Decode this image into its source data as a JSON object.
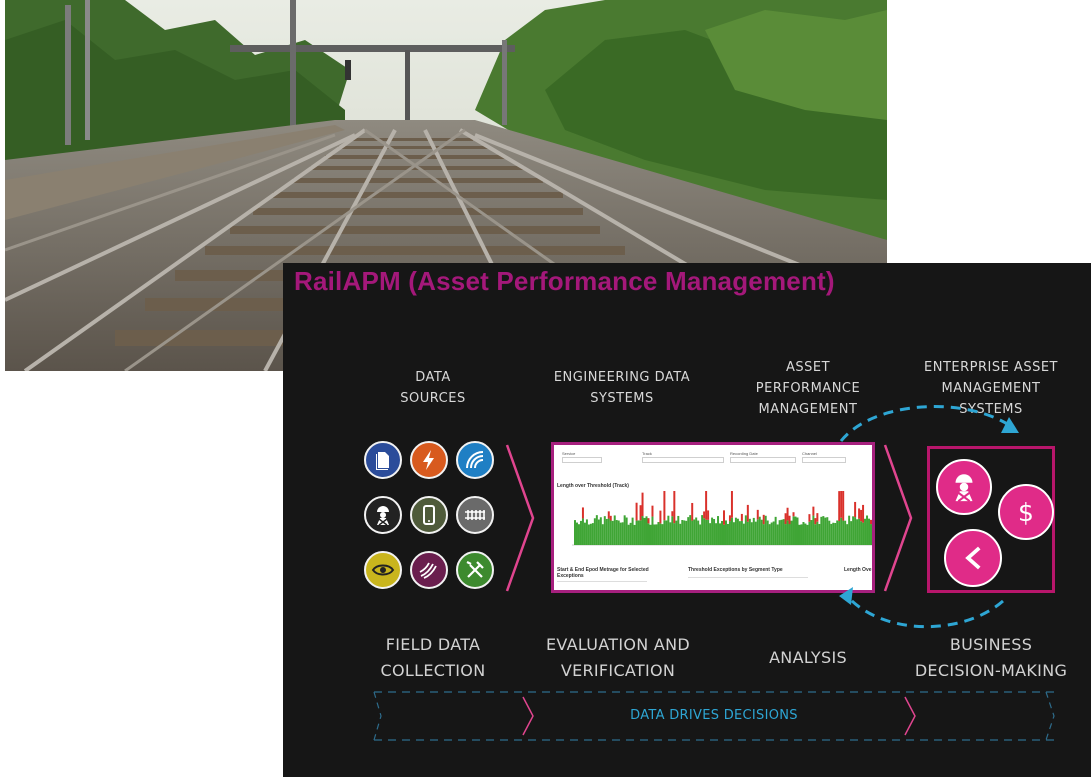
{
  "photo": {
    "description_icon": "railway-track-photo"
  },
  "slide": {
    "title": "RailAPM (Asset Performance Management)",
    "title_color": "#a4187a",
    "background": "#161616",
    "accent_pink": "#b8166b",
    "accent_blue": "#2ea6d4",
    "columns": [
      {
        "head": [
          "DATA",
          "SOURCES"
        ],
        "stage": [
          "FIELD DATA",
          "COLLECTION"
        ]
      },
      {
        "head": [
          "ENGINEERING DATA",
          "SYSTEMS"
        ],
        "stage": [
          "EVALUATION AND",
          "VERIFICATION"
        ]
      },
      {
        "head": [
          "ASSET",
          "PERFORMANCE",
          "MANAGEMENT"
        ],
        "stage": [
          "ANALYSIS"
        ]
      },
      {
        "head": [
          "ENTERPRISE ASSET",
          "MANAGEMENT",
          "SYSTEMS"
        ],
        "stage": [
          "BUSINESS",
          "DECISION-MAKING"
        ]
      }
    ],
    "data_source_icons": [
      {
        "name": "document-icon",
        "color": "#2b4c9a"
      },
      {
        "name": "lightning-icon",
        "color": "#d85a1e"
      },
      {
        "name": "signal-waves-icon",
        "color": "#1f7fc4"
      },
      {
        "name": "worker-icon",
        "color": "#222222"
      },
      {
        "name": "mobile-device-icon",
        "color": "#4f5b3a"
      },
      {
        "name": "track-icon",
        "color": "#6a6a6a"
      },
      {
        "name": "eye-icon",
        "color": "#c9b51d"
      },
      {
        "name": "lines-icon",
        "color": "#6a1e4e"
      },
      {
        "name": "tools-icon",
        "color": "#3d8a2e"
      }
    ],
    "dashboard": {
      "chart_title": "Length over Threshold (Track)",
      "table1_title": "Start & End Epod Metrage for Selected Exceptions",
      "table2_title": "Threshold Exceptions by Segment Type",
      "table3_title": "Length Ove"
    },
    "enterprise_icons": [
      "worker-icon",
      "dollar-icon",
      "share-icon"
    ],
    "footer_banner": "DATA DRIVES DECISIONS"
  }
}
